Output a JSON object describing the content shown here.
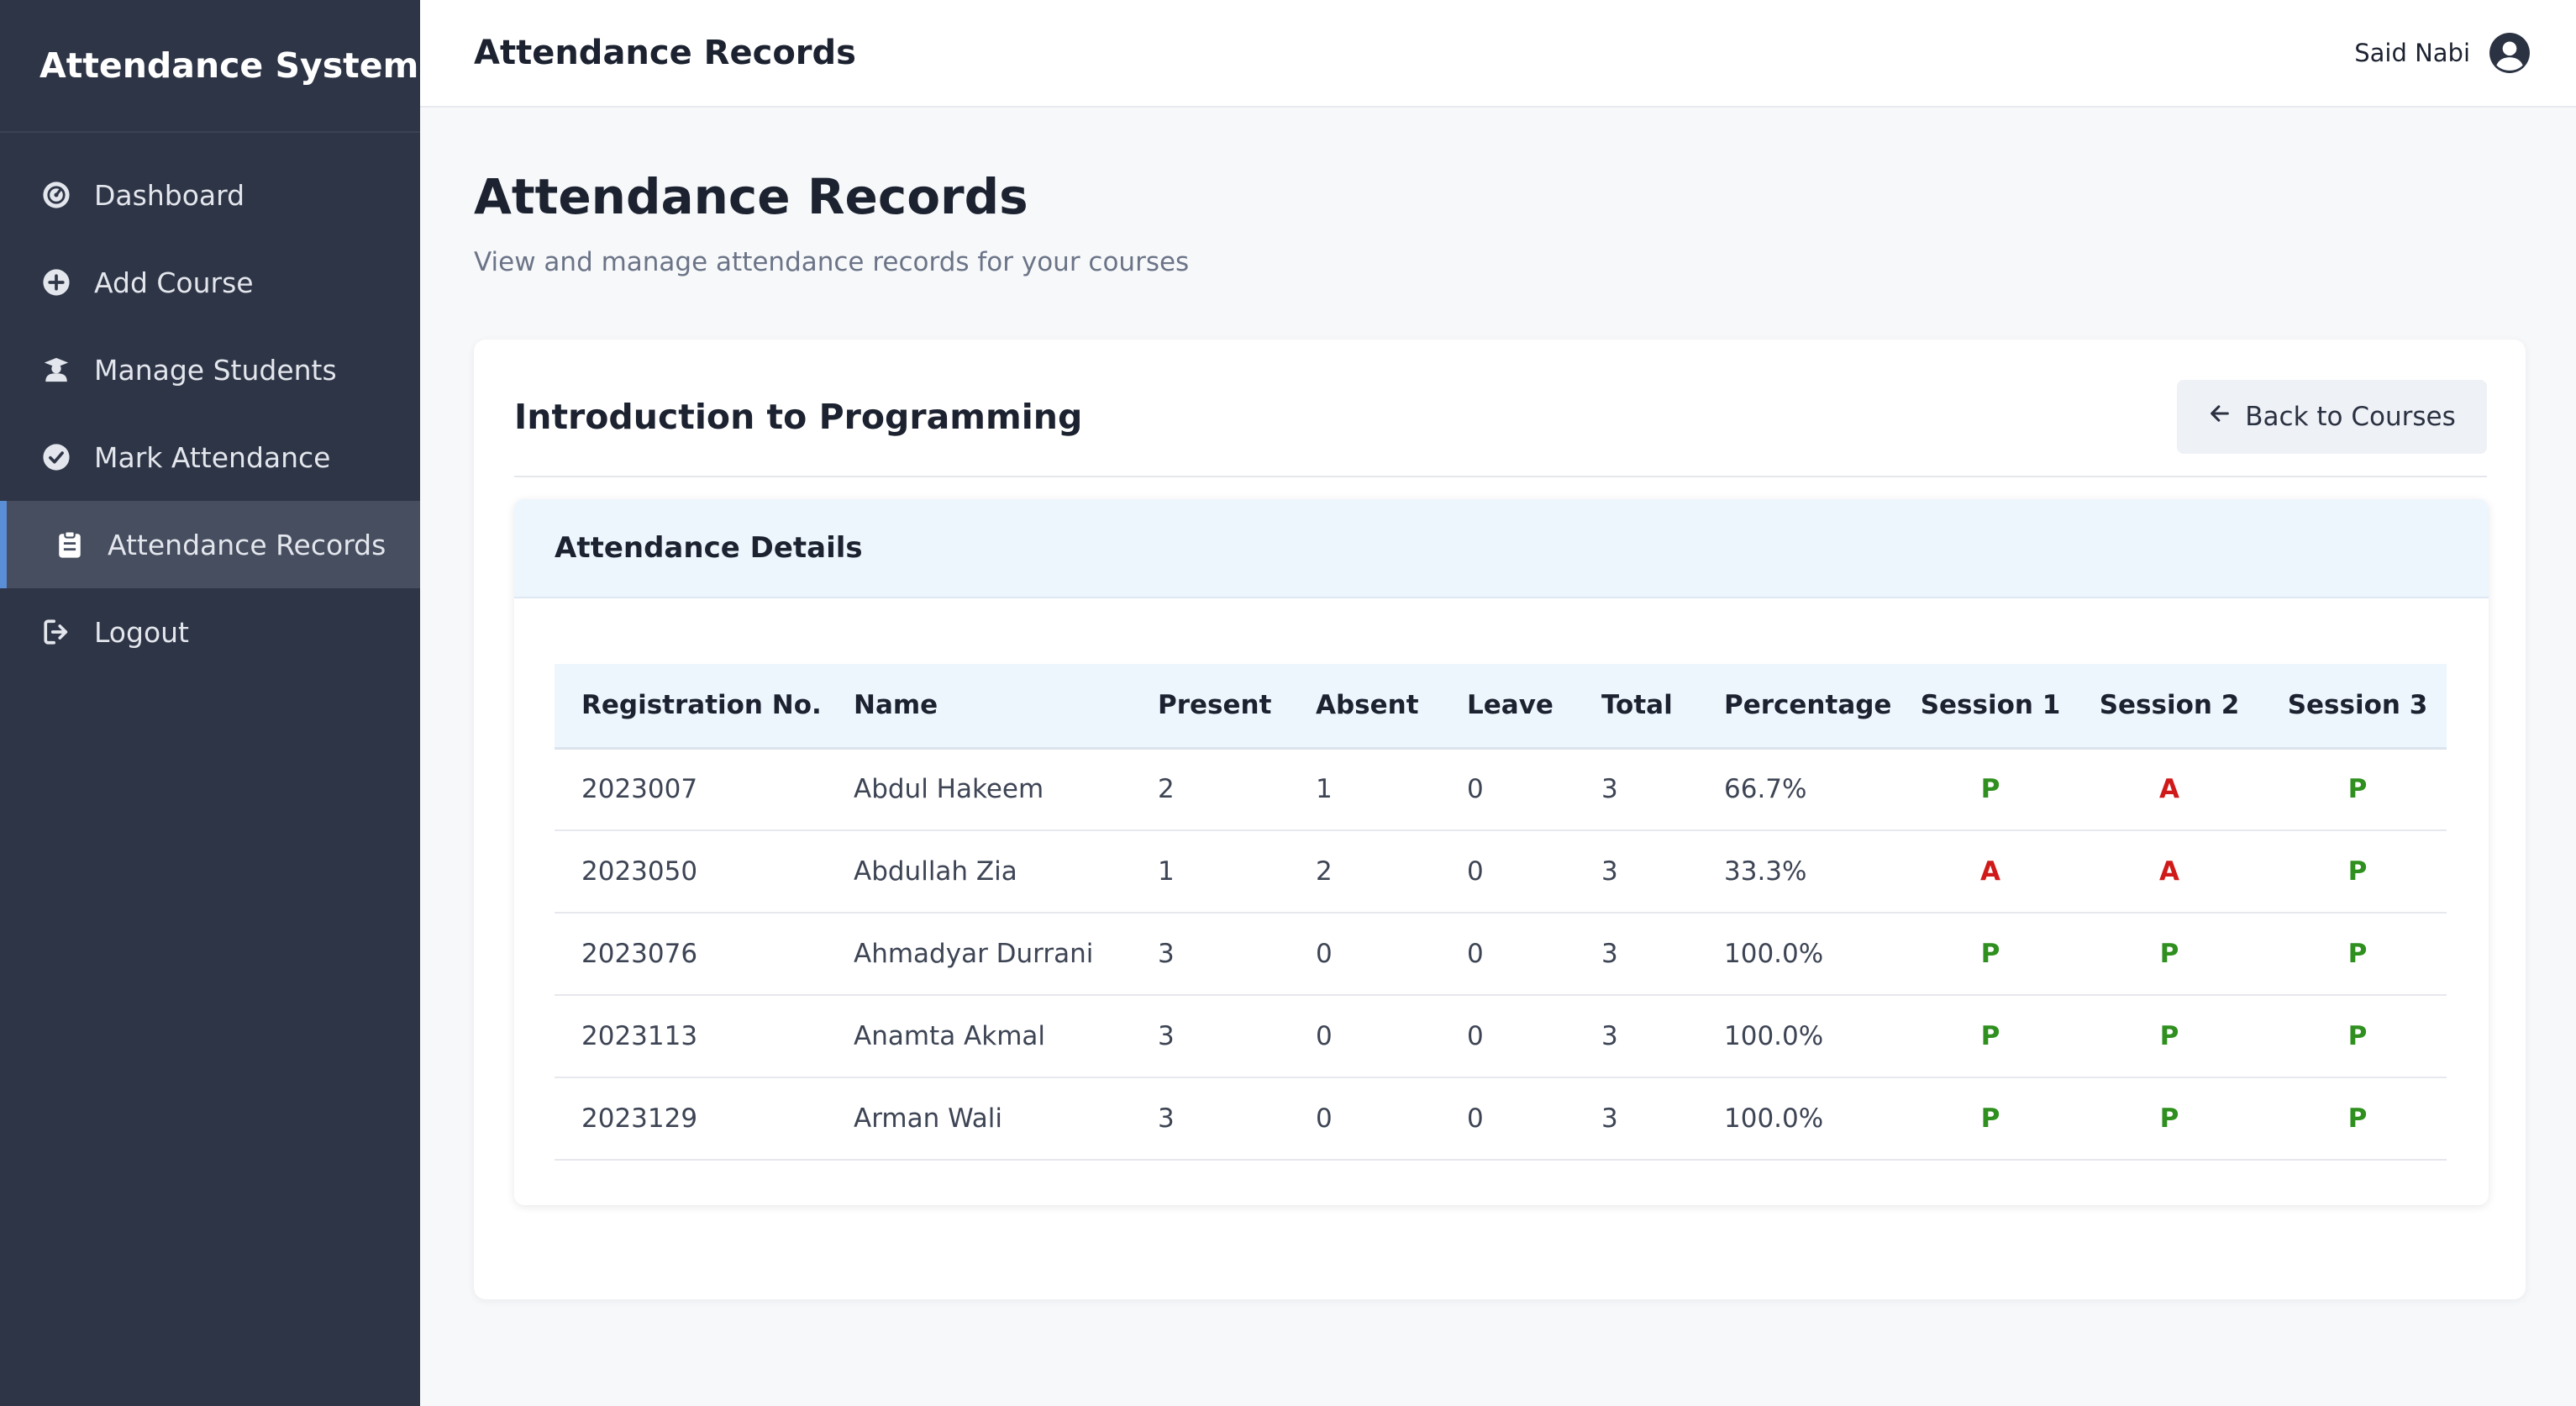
{
  "app": {
    "title": "Attendance System"
  },
  "sidebar": {
    "items": [
      {
        "label": "Dashboard",
        "icon": "dashboard-icon"
      },
      {
        "label": "Add Course",
        "icon": "plus-circle-icon"
      },
      {
        "label": "Manage Students",
        "icon": "student-icon"
      },
      {
        "label": "Mark Attendance",
        "icon": "check-circle-icon"
      },
      {
        "label": "Attendance Records",
        "icon": "clipboard-icon",
        "active": true
      },
      {
        "label": "Logout",
        "icon": "logout-icon"
      }
    ]
  },
  "header": {
    "title": "Attendance Records",
    "user_name": "Said Nabi"
  },
  "page": {
    "title": "Attendance Records",
    "subtitle": "View and manage attendance records for your courses"
  },
  "course": {
    "title": "Introduction to Programming",
    "back_label": "Back to Courses"
  },
  "details": {
    "title": "Attendance Details",
    "columns": [
      "Registration No.",
      "Name",
      "Present",
      "Absent",
      "Leave",
      "Total",
      "Percentage",
      "Session 1",
      "Session 2",
      "Session 3"
    ],
    "rows": [
      {
        "reg": "2023007",
        "name": "Abdul Hakeem",
        "present": "2",
        "absent": "1",
        "leave": "0",
        "total": "3",
        "percentage": "66.7%",
        "s1": "P",
        "s2": "A",
        "s3": "P"
      },
      {
        "reg": "2023050",
        "name": "Abdullah Zia",
        "present": "1",
        "absent": "2",
        "leave": "0",
        "total": "3",
        "percentage": "33.3%",
        "s1": "A",
        "s2": "A",
        "s3": "P"
      },
      {
        "reg": "2023076",
        "name": "Ahmadyar Durrani",
        "present": "3",
        "absent": "0",
        "leave": "0",
        "total": "3",
        "percentage": "100.0%",
        "s1": "P",
        "s2": "P",
        "s3": "P"
      },
      {
        "reg": "2023113",
        "name": "Anamta Akmal",
        "present": "3",
        "absent": "0",
        "leave": "0",
        "total": "3",
        "percentage": "100.0%",
        "s1": "P",
        "s2": "P",
        "s3": "P"
      },
      {
        "reg": "2023129",
        "name": "Arman Wali",
        "present": "3",
        "absent": "0",
        "leave": "0",
        "total": "3",
        "percentage": "100.0%",
        "s1": "P",
        "s2": "P",
        "s3": "P"
      }
    ]
  },
  "colors": {
    "sidebar_bg": "#2e3546",
    "active_accent": "#5a8ed6",
    "present": "#2f8f1f",
    "absent": "#d01a1a"
  }
}
